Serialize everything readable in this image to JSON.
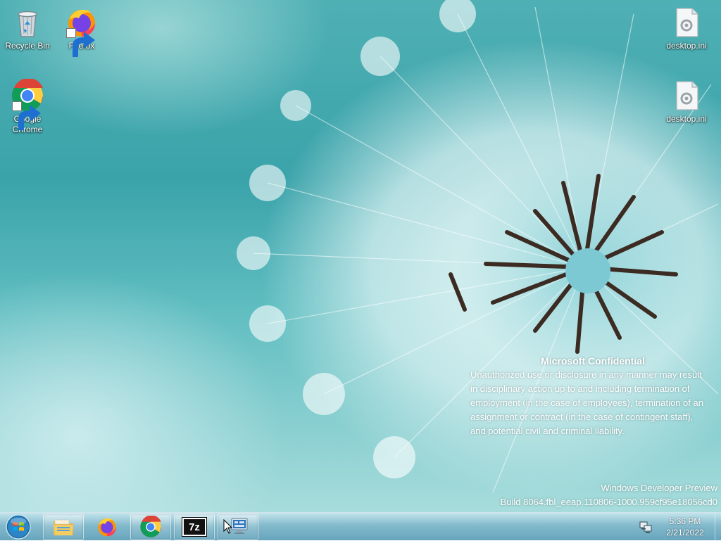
{
  "desktop_icons": [
    {
      "label": "Recycle Bin",
      "icon": "recycle-bin-icon"
    },
    {
      "label": "Firefox",
      "icon": "firefox-icon"
    },
    {
      "label": "Google Chrome",
      "icon": "chrome-icon"
    },
    {
      "label": "desktop.ini",
      "icon": "ini-file-icon"
    },
    {
      "label": "desktop.ini",
      "icon": "ini-file-icon"
    }
  ],
  "watermark": {
    "title": "Microsoft Confidential",
    "body": "Unauthorized use or disclosure in any manner may result in disciplinary action up to and including termination of employment (in the case of employees), termination of an assignment or contract (in the case of contingent staff), and potential civil and criminal liability."
  },
  "build": {
    "edition": "Windows Developer Preview",
    "build_string": "Build 8064.fbl_eeap.110806-1000.959cf95e18056cd0"
  },
  "taskbar": {
    "start_icon": "windows-orb-icon",
    "pinned": [
      {
        "icon": "file-explorer-icon"
      },
      {
        "icon": "firefox-icon"
      },
      {
        "icon": "chrome-icon"
      },
      {
        "icon": "7zip-icon",
        "text": "7z"
      },
      {
        "icon": "remote-desktop-icon"
      }
    ],
    "tray": {
      "time": "5:36 PM",
      "date": "2/21/2022"
    }
  },
  "colors": {
    "wallpaper_teal": "#3aa3aa",
    "taskbar": "#78b4c8",
    "text": "#ffffff"
  }
}
